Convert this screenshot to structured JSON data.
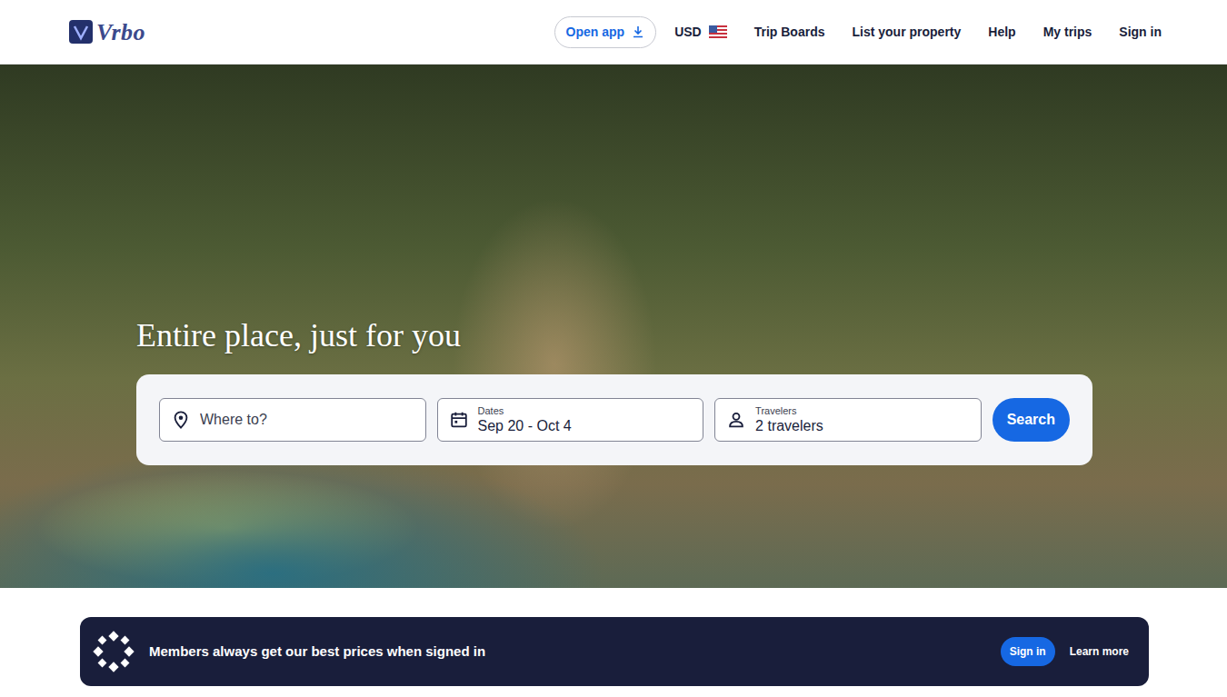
{
  "header": {
    "logo": "Vrbo",
    "open_app": "Open app",
    "currency": "USD",
    "nav": [
      "Trip Boards",
      "List your property",
      "Help",
      "My trips",
      "Sign in"
    ]
  },
  "hero": {
    "headline": "Entire place, just for you"
  },
  "search": {
    "destination": {
      "placeholder": "Where to?"
    },
    "dates": {
      "label": "Dates",
      "value": "Sep 20 - Oct 4"
    },
    "travelers": {
      "label": "Travelers",
      "value": "2 travelers"
    },
    "button": "Search"
  },
  "banner": {
    "text": "Members always get our best prices when signed in",
    "sign_in": "Sign in",
    "learn_more": "Learn more"
  }
}
